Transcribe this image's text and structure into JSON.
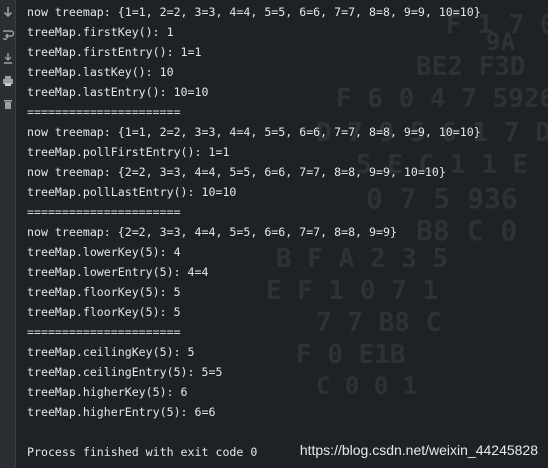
{
  "gutter_tools": [
    {
      "icon": "arrow-down-icon"
    },
    {
      "icon": "soft-wrap-icon"
    },
    {
      "icon": "scroll-to-end-icon"
    },
    {
      "icon": "print-icon"
    },
    {
      "icon": "trash-icon"
    }
  ],
  "console": {
    "lines": [
      "now treemap: {1=1, 2=2, 3=3, 4=4, 5=5, 6=6, 7=7, 8=8, 9=9, 10=10}",
      "treeMap.firstKey(): 1",
      "treeMap.firstEntry(): 1=1",
      "treeMap.lastKey(): 10",
      "treeMap.lastEntry(): 10=10",
      "======================",
      "now treemap: {1=1, 2=2, 3=3, 4=4, 5=5, 6=6, 7=7, 8=8, 9=9, 10=10}",
      "treeMap.pollFirstEntry(): 1=1",
      "now treemap: {2=2, 3=3, 4=4, 5=5, 6=6, 7=7, 8=8, 9=9, 10=10}",
      "treeMap.pollLastEntry(): 10=10",
      "======================",
      "now treemap: {2=2, 3=3, 4=4, 5=5, 6=6, 7=7, 8=8, 9=9}",
      "treeMap.lowerKey(5): 4",
      "treeMap.lowerEntry(5): 4=4",
      "treeMap.floorKey(5): 5",
      "treeMap.floorKey(5): 5",
      "======================",
      "treeMap.ceilingKey(5): 5",
      "treeMap.ceilingEntry(5): 5=5",
      "treeMap.higherKey(5): 6",
      "treeMap.higherEntry(5): 6=6",
      "",
      "Process finished with exit code 0"
    ]
  },
  "watermark": "https://blog.csdn.net/weixin_44245828",
  "colors": {
    "background": "#1e2226",
    "text": "#e6e6e6",
    "gutter": "#2b2e32"
  }
}
